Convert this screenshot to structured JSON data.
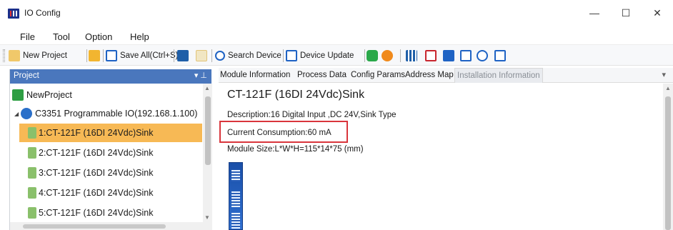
{
  "window": {
    "title": "IO Config",
    "controls": {
      "minimize": "—",
      "maximize": "☐",
      "close": "✕"
    }
  },
  "menu": [
    "File",
    "Tool",
    "Option",
    "Help"
  ],
  "toolbar": {
    "new_project_label": "New Project",
    "save_all_label": "Save All(Ctrl+S)",
    "search_device_label": "Search Device",
    "device_update_label": "Device Update"
  },
  "project_pane": {
    "header": "Project",
    "pin_glyph": "▾ ⊥",
    "root": "NewProject",
    "device": "C3351 Programmable IO(192.168.1.100)",
    "modules": [
      "1:CT-121F (16DI 24Vdc)Sink",
      "2:CT-121F (16DI 24Vdc)Sink",
      "3:CT-121F (16DI 24Vdc)Sink",
      "4:CT-121F (16DI 24Vdc)Sink",
      "5:CT-121F (16DI 24Vdc)Sink"
    ],
    "selected_index": 0
  },
  "tabs": [
    {
      "label": "Module Information",
      "active": false
    },
    {
      "label": "Process Data",
      "active": false
    },
    {
      "label": "Config Params",
      "active": false
    },
    {
      "label": "Address Map",
      "active": false
    },
    {
      "label": "Installation Information",
      "active": true
    }
  ],
  "module_info": {
    "title": "CT-121F (16DI 24Vdc)Sink",
    "description": "Description:16 Digital Input ,DC 24V,Sink Type",
    "current_consumption": "Current Consumption:60 mA",
    "module_size": "Module Size:L*W*H=115*14*75 (mm)"
  },
  "colors": {
    "pane_header": "#4a77bd",
    "selected_row": "#f7b955",
    "highlight_box": "#d9353c"
  }
}
